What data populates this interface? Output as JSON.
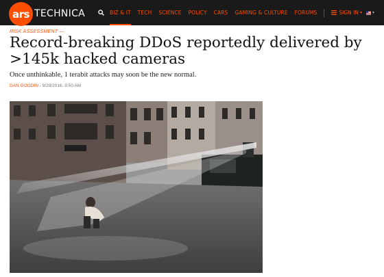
{
  "brand": {
    "logo_mark": "ars",
    "logo_word": "TECHNICA",
    "accent": "#ff4e00",
    "nav_bg": "#1a1a1a"
  },
  "nav": {
    "search_icon": "search-icon",
    "items": [
      {
        "label": "BIZ & IT",
        "active": true
      },
      {
        "label": "TECH",
        "active": false
      },
      {
        "label": "SCIENCE",
        "active": false
      },
      {
        "label": "POLICY",
        "active": false
      },
      {
        "label": "CARS",
        "active": false
      },
      {
        "label": "GAMING & CULTURE",
        "active": false
      },
      {
        "label": "FORUMS",
        "active": false
      }
    ],
    "signin_label": "SIGN IN",
    "edition_icon": "us-flag-icon"
  },
  "article": {
    "kicker": "RISK ASSESSMENT —",
    "headline": "Record-breaking DDoS reportedly delivered by >145k hacked cameras",
    "dek": "Once unthinkable, 1 terabit attacks may soon be the new normal.",
    "author": "DAN GOODIN",
    "date": " - 9/29/2016, 9:50 AM"
  }
}
